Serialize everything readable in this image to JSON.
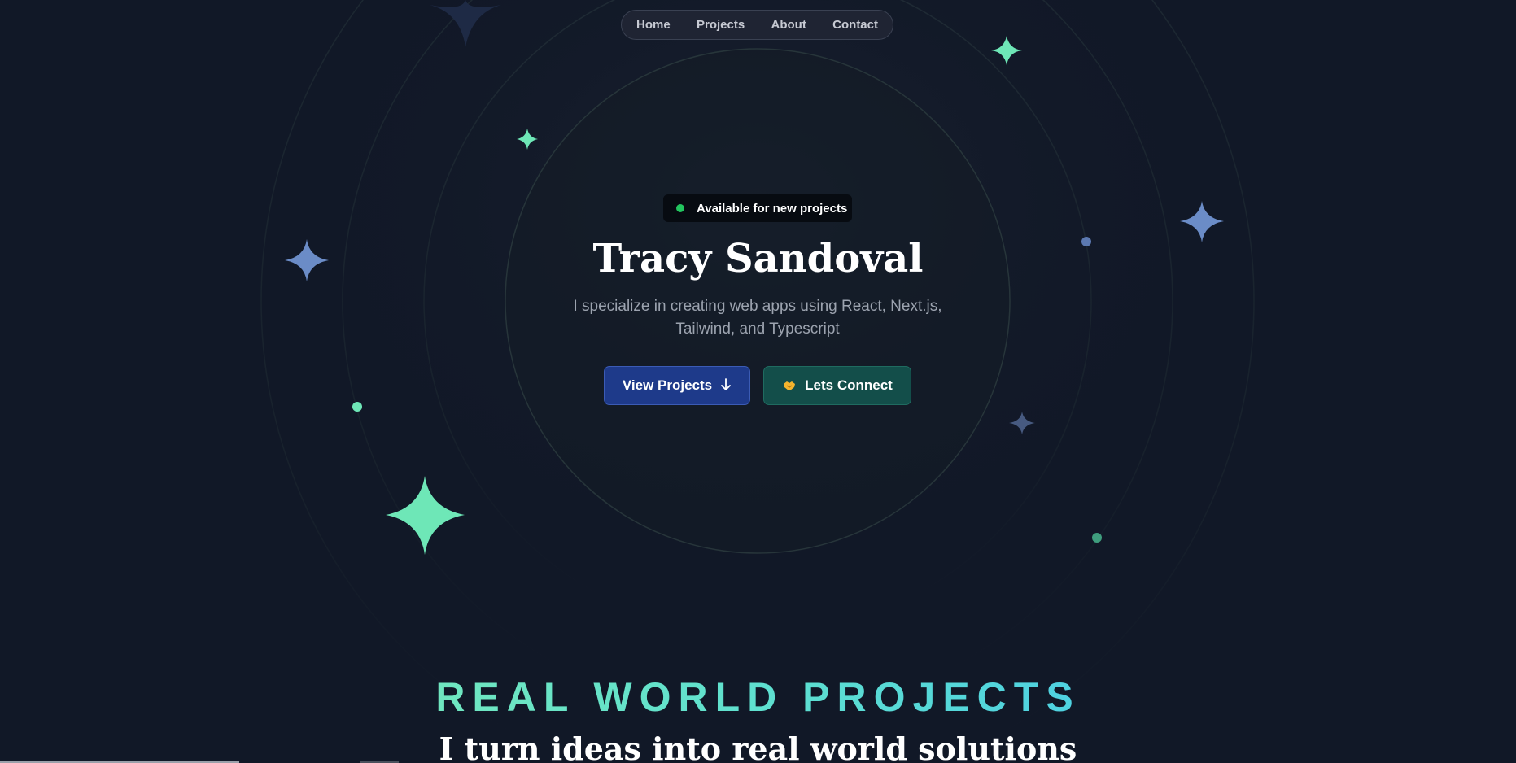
{
  "nav": {
    "items": [
      {
        "label": "Home"
      },
      {
        "label": "Projects"
      },
      {
        "label": "About"
      },
      {
        "label": "Contact"
      }
    ]
  },
  "hero": {
    "badge": "Available for new projects",
    "title": "Tracy Sandoval",
    "subtitle": "I specialize in creating web apps using React, Next.js, Tailwind, and Typescript",
    "primary_button": "View Projects",
    "secondary_button": "Lets Connect"
  },
  "projects_section": {
    "kicker": "REAL WORLD PROJECTS",
    "heading": "I turn ideas into real world solutions"
  },
  "colors": {
    "background": "#111827",
    "accent_green": "#6ee7b7",
    "accent_blue": "#6b8cc7",
    "status_dot": "#22c55e",
    "primary_button": "#1e3a8a",
    "secondary_button": "#134e4a"
  },
  "icons": {
    "status": "status-dot-icon",
    "arrow": "arrow-down-icon",
    "connect": "handshake-icon",
    "sparkle": "sparkle-icon"
  }
}
